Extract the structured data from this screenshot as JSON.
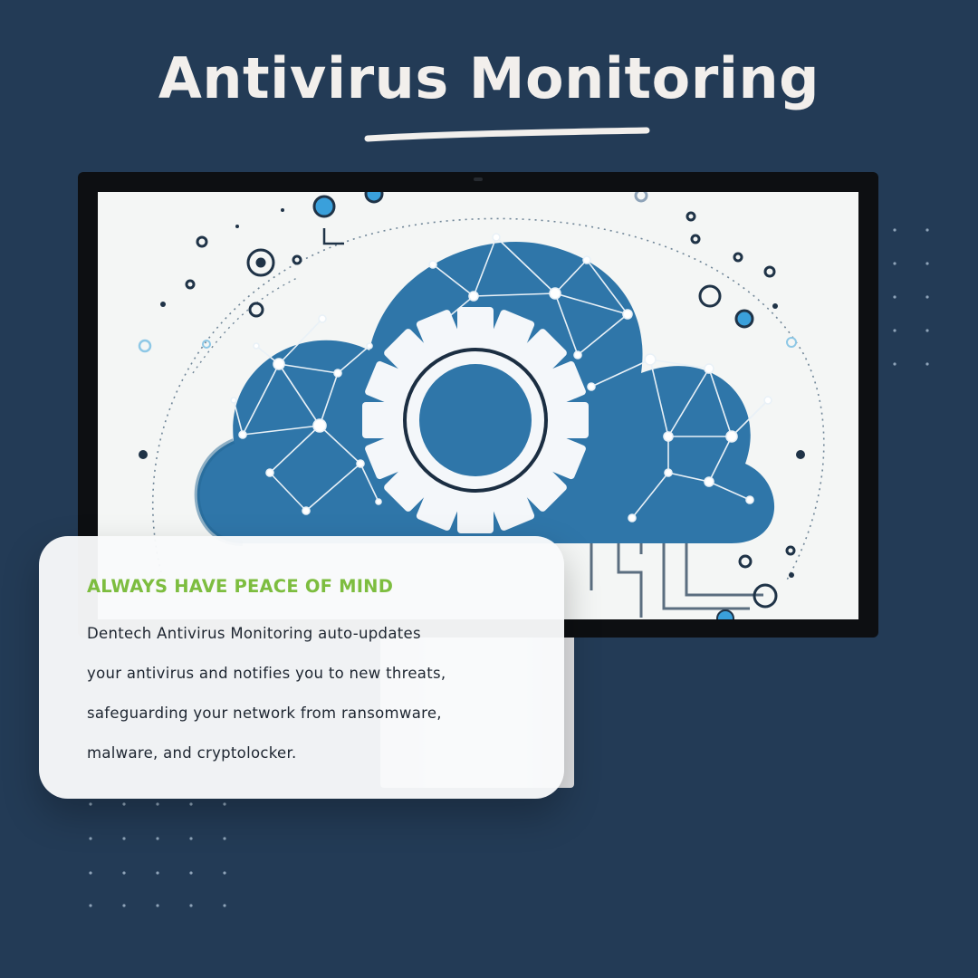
{
  "header": {
    "title": "Antivirus Monitoring"
  },
  "card": {
    "heading": "ALWAYS HAVE PEACE OF MIND",
    "lines": [
      "Dentech Antivirus Monitoring auto-updates",
      "your antivirus and notifies you to new threats,",
      "safeguarding your network from ransomware,",
      "malware, and cryptolocker."
    ]
  },
  "illustration": {
    "subject": "cloud-gear-network-illustration",
    "icons": [
      "cloud-icon",
      "gear-icon",
      "network-nodes-icon",
      "circuit-lines-icon"
    ]
  },
  "colors": {
    "background": "#233b56",
    "accent_green": "#7dbd3f",
    "cloud_blue": "#2f76a9",
    "title_text": "#f2efec"
  }
}
